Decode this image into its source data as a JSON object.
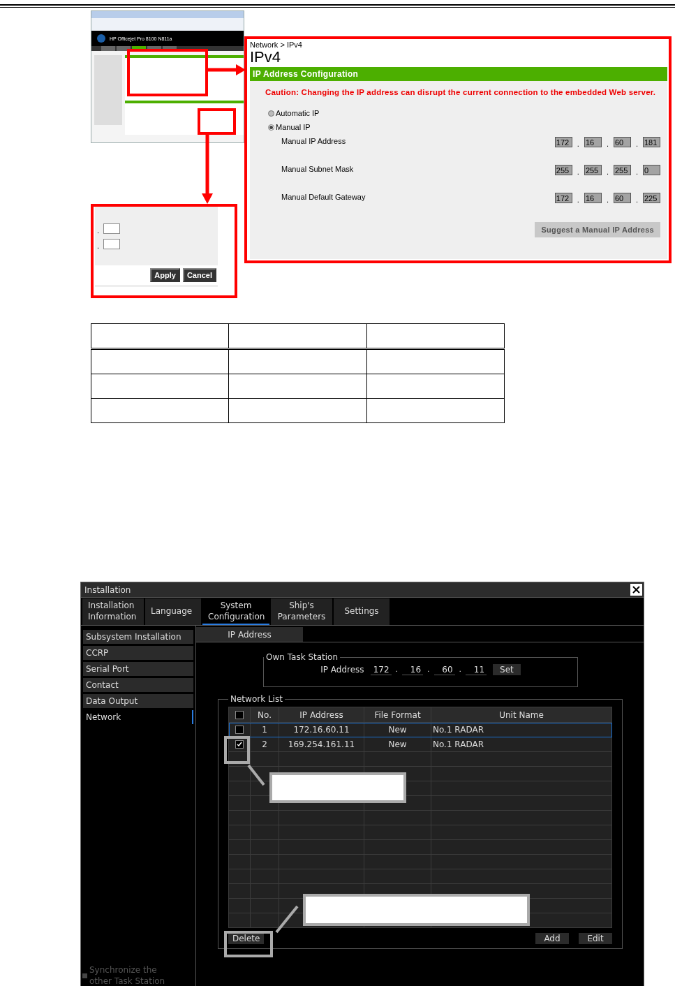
{
  "figure_1": {
    "browser": {
      "title": "HP Officejet Pro 8100 N811a"
    },
    "ipv4_panel": {
      "breadcrumb": "Network > IPv4",
      "heading": "IPv4",
      "section_title": "IP Address Configuration",
      "caution": "Caution: Changing the IP address can disrupt the current connection to the embedded Web server.",
      "modes": [
        {
          "label": "Automatic IP",
          "selected": false
        },
        {
          "label": "Manual IP",
          "selected": true
        }
      ],
      "fields": [
        {
          "label": "Manual IP Address",
          "separator": ".",
          "octets": [
            "172",
            "16",
            "60",
            "181"
          ]
        },
        {
          "label": "Manual Subnet Mask",
          "separator": ".",
          "octets": [
            "255",
            "255",
            "255",
            "0"
          ]
        },
        {
          "label": "Manual Default Gateway",
          "separator": ".",
          "octets": [
            "172",
            "16",
            "60",
            "225"
          ]
        }
      ],
      "button": "Suggest a Manual IP Address"
    },
    "buttons_panel": {
      "separator": ".",
      "buttons": [
        "Apply",
        "Cancel"
      ]
    }
  },
  "installation_dialog": {
    "title": "Installation",
    "tabs": [
      {
        "label": "Installation\nInformation",
        "selected": false
      },
      {
        "label": "Language",
        "selected": false
      },
      {
        "label": "System\nConfiguration",
        "selected": true
      },
      {
        "label": "Ship's\nParameters",
        "selected": false
      },
      {
        "label": "Settings",
        "selected": false
      }
    ],
    "side_items": [
      {
        "label": "Subsystem Installation",
        "selected": false
      },
      {
        "label": "CCRP",
        "selected": false
      },
      {
        "label": "Serial Port",
        "selected": false
      },
      {
        "label": "Contact",
        "selected": false
      },
      {
        "label": "Data Output",
        "selected": false
      },
      {
        "label": "Network",
        "selected": true
      }
    ],
    "sync": {
      "label": "Synchronize the other Task Station",
      "checked": false
    },
    "subtab": "IP Address",
    "own_task_station": {
      "legend": "Own Task Station",
      "label": "IP Address",
      "separator": ".",
      "octets": [
        "172",
        "16",
        "60",
        "11"
      ],
      "button": "Set"
    },
    "network_list": {
      "legend": "Network List",
      "header_checked": false,
      "columns": [
        "No.",
        "IP Address",
        "File Format",
        "Unit Name"
      ],
      "rows": [
        {
          "checked": false,
          "selected": true,
          "cells": [
            "1",
            "172.16.60.11",
            "New",
            "No.1 RADAR"
          ]
        },
        {
          "checked": true,
          "selected": false,
          "cells": [
            "2",
            "169.254.161.11",
            "New",
            "No.1 RADAR"
          ]
        }
      ],
      "buttons": [
        "Delete",
        "Add",
        "Edit"
      ]
    }
  }
}
